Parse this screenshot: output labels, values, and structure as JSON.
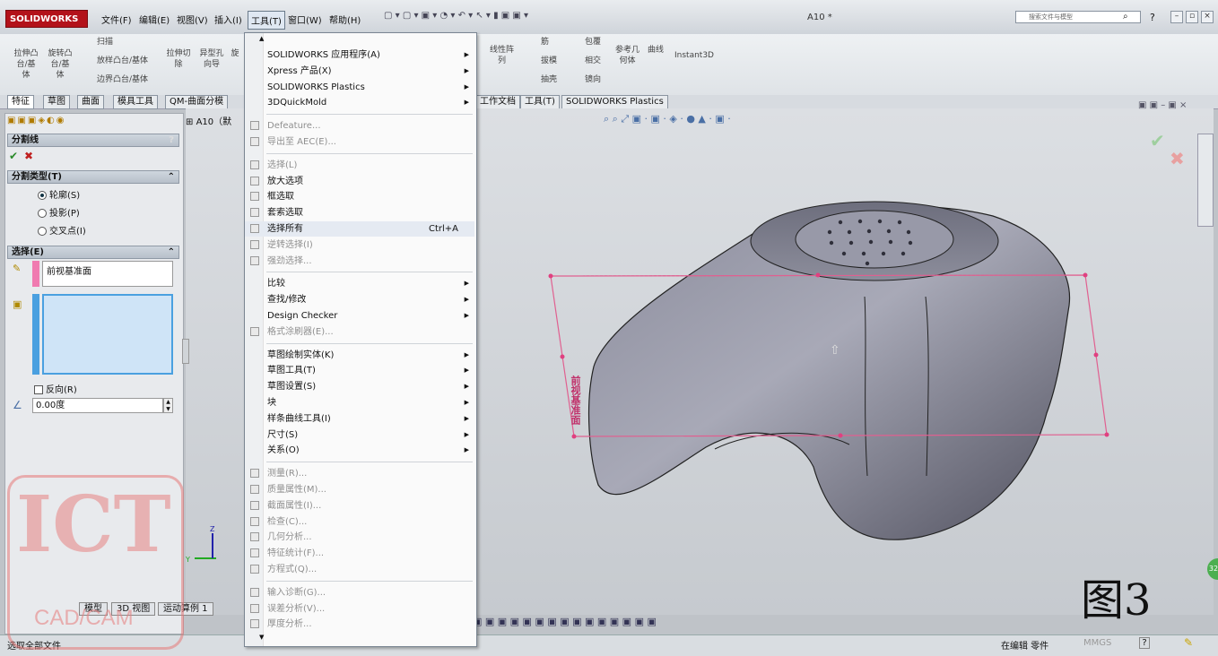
{
  "app": {
    "brand": "SOLIDWORKS",
    "doc_title": "A10 *",
    "search_placeholder": "搜索文件与模型"
  },
  "menubar": [
    "文件(F)",
    "编辑(E)",
    "视图(V)",
    "插入(I)",
    "工具(T)",
    "窗口(W)",
    "帮助(H)"
  ],
  "commands_left": [
    {
      "label": "拉伸凸\n台/基\n体"
    },
    {
      "label": "旋转凸\n台/基\n体"
    },
    {
      "label": "扫描"
    },
    {
      "label": "放样凸台/基体"
    },
    {
      "label": "边界凸台/基体"
    },
    {
      "label": "拉伸切\n除"
    },
    {
      "label": "异型孔\n向导"
    },
    {
      "label": "旋"
    }
  ],
  "commands_right": [
    "线性阵\n列",
    "筋",
    "拔模",
    "抽壳",
    "包覆",
    "相交",
    "镜向",
    "参考几\n何体",
    "曲线",
    "Instant3D"
  ],
  "tabs_left": [
    "特征",
    "草图",
    "曲面",
    "模具工具",
    "QM-曲面分模"
  ],
  "tabs_right": [
    "工作文档",
    "工具(T)",
    "SOLIDWORKS Plastics"
  ],
  "tree_label": "A10（默",
  "panel": {
    "title": "分割线",
    "help": "?",
    "section_type": "分割类型(T)",
    "radios": [
      {
        "label": "轮廓(S)",
        "on": true
      },
      {
        "label": "投影(P)",
        "on": false
      },
      {
        "label": "交叉点(I)",
        "on": false
      }
    ],
    "section_select": "选择(E)",
    "selection1": "前视基准面",
    "reverse": "反向(R)",
    "angle": "0.00度"
  },
  "dropdown": [
    {
      "label": "SOLIDWORKS 应用程序(A)",
      "sub": true
    },
    {
      "label": "Xpress 产品(X)",
      "sub": true
    },
    {
      "label": "SOLIDWORKS Plastics",
      "sub": true
    },
    {
      "label": "3DQuickMold",
      "sub": true
    },
    {
      "sep": true
    },
    {
      "label": "Defeature...",
      "dis": true,
      "icon": true
    },
    {
      "label": "导出至 AEC(E)...",
      "dis": true,
      "icon": true
    },
    {
      "sep": true
    },
    {
      "label": "选择(L)",
      "dis": true,
      "icon": true
    },
    {
      "label": "放大选项",
      "icon": true
    },
    {
      "label": "框选取",
      "icon": true
    },
    {
      "label": "套索选取",
      "icon": true
    },
    {
      "label": "选择所有",
      "shortcut": "Ctrl+A",
      "hl": true,
      "icon": true
    },
    {
      "label": "逆转选择(I)",
      "dis": true,
      "icon": true
    },
    {
      "label": "强劲选择...",
      "dis": true,
      "icon": true
    },
    {
      "sep": true
    },
    {
      "label": "比较",
      "sub": true
    },
    {
      "label": "查找/修改",
      "sub": true
    },
    {
      "label": "Design Checker",
      "sub": true
    },
    {
      "label": "格式涂刷器(E)...",
      "dis": true,
      "icon": true
    },
    {
      "sep": true
    },
    {
      "label": "草图绘制实体(K)",
      "sub": true
    },
    {
      "label": "草图工具(T)",
      "sub": true
    },
    {
      "label": "草图设置(S)",
      "sub": true
    },
    {
      "label": "块",
      "sub": true
    },
    {
      "label": "样条曲线工具(I)",
      "sub": true
    },
    {
      "label": "尺寸(S)",
      "sub": true
    },
    {
      "label": "关系(O)",
      "sub": true
    },
    {
      "sep": true
    },
    {
      "label": "测量(R)...",
      "dis": true,
      "icon": true
    },
    {
      "label": "质量属性(M)...",
      "dis": true,
      "icon": true
    },
    {
      "label": "截面属性(I)...",
      "dis": true,
      "icon": true
    },
    {
      "label": "检查(C)...",
      "dis": true,
      "icon": true
    },
    {
      "label": "几何分析...",
      "dis": true,
      "icon": true
    },
    {
      "label": "特征统计(F)...",
      "dis": true,
      "icon": true
    },
    {
      "label": "方程式(Q)...",
      "dis": true,
      "icon": true
    },
    {
      "sep": true
    },
    {
      "label": "输入诊断(G)...",
      "dis": true,
      "icon": true
    },
    {
      "label": "误差分析(V)...",
      "dis": true,
      "icon": true
    },
    {
      "label": "厚度分析...",
      "dis": true,
      "icon": true
    }
  ],
  "plane_label": "前视基准面",
  "bottom_tabs": [
    "模型",
    "3D 视图",
    "运动算例 1"
  ],
  "status": {
    "left": "选取全部文件",
    "right1": "在编辑 零件",
    "right2": "MMGS"
  },
  "watermark": {
    "big": "ICT",
    "small": "CAD/CAM"
  },
  "figure_label": "图3",
  "side_badge": "32"
}
